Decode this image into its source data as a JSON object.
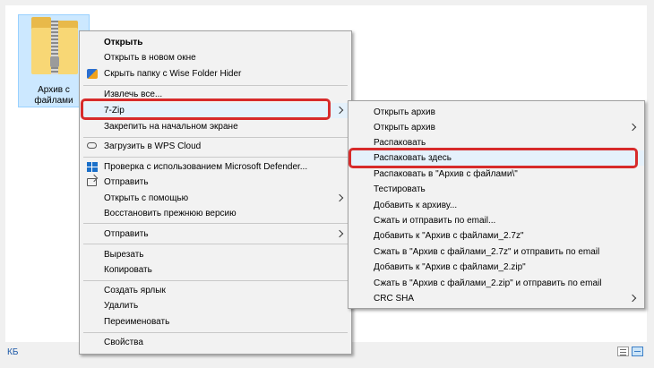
{
  "folder": {
    "label_line1": "Архив с",
    "label_line2": "файлами"
  },
  "status_bar": {
    "size_text": "КБ"
  },
  "context_menu": {
    "items": [
      {
        "label": "Открыть"
      },
      {
        "label": "Открыть в новом окне"
      },
      {
        "label": "Скрыть папку с Wise Folder Hider"
      },
      {
        "label": "Извлечь все..."
      },
      {
        "label": "7-Zip"
      },
      {
        "label": "Закрепить на начальном экране"
      },
      {
        "label": "Загрузить в WPS Cloud"
      },
      {
        "label": "Проверка с использованием Microsoft Defender..."
      },
      {
        "label": "Отправить"
      },
      {
        "label": "Открыть с помощью"
      },
      {
        "label": "Восстановить прежнюю версию"
      },
      {
        "label": "Отправить"
      },
      {
        "label": "Вырезать"
      },
      {
        "label": "Копировать"
      },
      {
        "label": "Создать ярлык"
      },
      {
        "label": "Удалить"
      },
      {
        "label": "Переименовать"
      },
      {
        "label": "Свойства"
      }
    ]
  },
  "zip_submenu": {
    "items": [
      {
        "label": "Открыть архив"
      },
      {
        "label": "Открыть архив"
      },
      {
        "label": "Распаковать"
      },
      {
        "label": "Распаковать здесь"
      },
      {
        "label": "Распаковать в \"Архив с файлами\\\""
      },
      {
        "label": "Тестировать"
      },
      {
        "label": "Добавить к архиву..."
      },
      {
        "label": "Сжать и отправить по email..."
      },
      {
        "label": "Добавить к \"Архив с файлами_2.7z\""
      },
      {
        "label": "Сжать в \"Архив с файлами_2.7z\" и отправить по email"
      },
      {
        "label": "Добавить к \"Архив с файлами_2.zip\""
      },
      {
        "label": "Сжать в \"Архив с файлами_2.zip\" и отправить по email"
      },
      {
        "label": "CRC SHA"
      }
    ]
  },
  "colors": {
    "highlight_border": "#d72b2b",
    "selection": "#cce8ff"
  }
}
